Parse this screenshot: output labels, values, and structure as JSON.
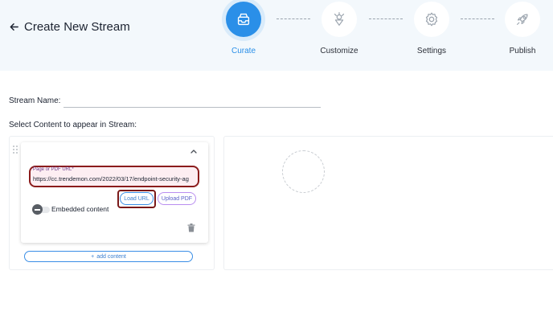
{
  "header": {
    "back_icon": "arrow-left-icon",
    "title": "Create New Stream",
    "steps": [
      {
        "label": "Curate",
        "icon": "tray-icon",
        "active": true
      },
      {
        "label": "Customize",
        "icon": "palette-icon",
        "active": false
      },
      {
        "label": "Settings",
        "icon": "gear-icon",
        "active": false
      },
      {
        "label": "Publish",
        "icon": "rocket-icon",
        "active": false
      }
    ]
  },
  "form": {
    "stream_name_label": "Stream Name:",
    "stream_name_value": "",
    "select_content_label": "Select Content to appear in Stream:"
  },
  "content_item": {
    "url_label": "Page or PDF URL",
    "url_required_mark": "*",
    "url_value": "https://cc.trendemon.com/2022/03/17/endpoint-security-ag",
    "load_url_label": "Load URL",
    "upload_pdf_label": "Upload PDF",
    "embedded_label": "Embedded content",
    "embedded_on": false
  },
  "add_content_label": "add content",
  "colors": {
    "accent": "#2a8fe8",
    "header_bg": "#f3f8fc",
    "annotation": "#8b1c1c"
  }
}
